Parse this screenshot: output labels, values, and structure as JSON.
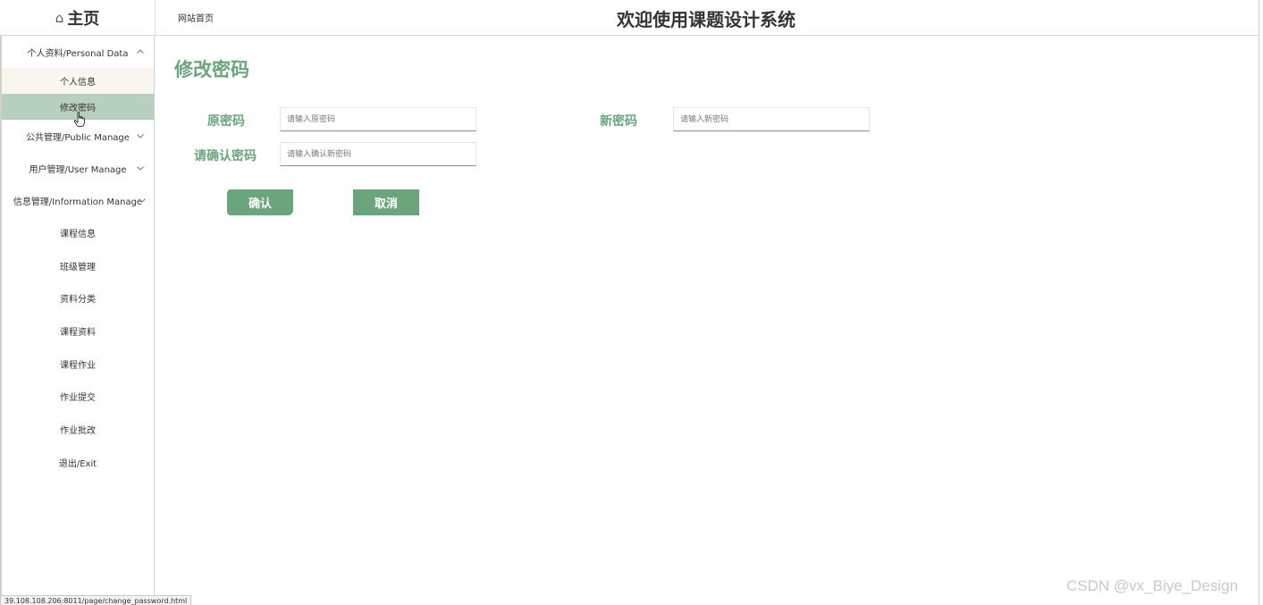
{
  "header": {
    "brand_glyph": "⌂",
    "brand_label": "主页",
    "site_link": "网站首页",
    "app_title": "欢迎使用课题设计系统"
  },
  "sidebar": {
    "groups": [
      {
        "label": "个人资料/Personal Data",
        "expanded": true
      },
      {
        "label": "公共管理/Public Manage",
        "expanded": false
      },
      {
        "label": "用户管理/User Manage",
        "expanded": false
      },
      {
        "label": "信息管理/Information Manage",
        "expanded": false
      }
    ],
    "personal_items": [
      "个人信息",
      "修改密码"
    ],
    "active_item": "修改密码",
    "info_items": [
      "课程信息",
      "班级管理",
      "资料分类",
      "课程资料",
      "课程作业",
      "作业提交",
      "作业批改",
      "退出/Exit"
    ]
  },
  "main": {
    "heading": "修改密码",
    "fields": {
      "old_password": {
        "label": "原密码",
        "placeholder": "请输入原密码",
        "value": ""
      },
      "new_password": {
        "label": "新密码",
        "placeholder": "请输入新密码",
        "value": ""
      },
      "confirm_password": {
        "label": "请确认密码",
        "placeholder": "请输入确认新密码",
        "value": ""
      }
    },
    "confirm_label": "确认",
    "cancel_label": "取消"
  },
  "status_url": "39.108.108.206:8011/page/change_password.html",
  "watermark": "CSDN @vx_Biye_Design",
  "colors": {
    "accent": "#6aa57b",
    "active_bg": "#b7cfbf",
    "light_bg": "#faf6ef"
  }
}
